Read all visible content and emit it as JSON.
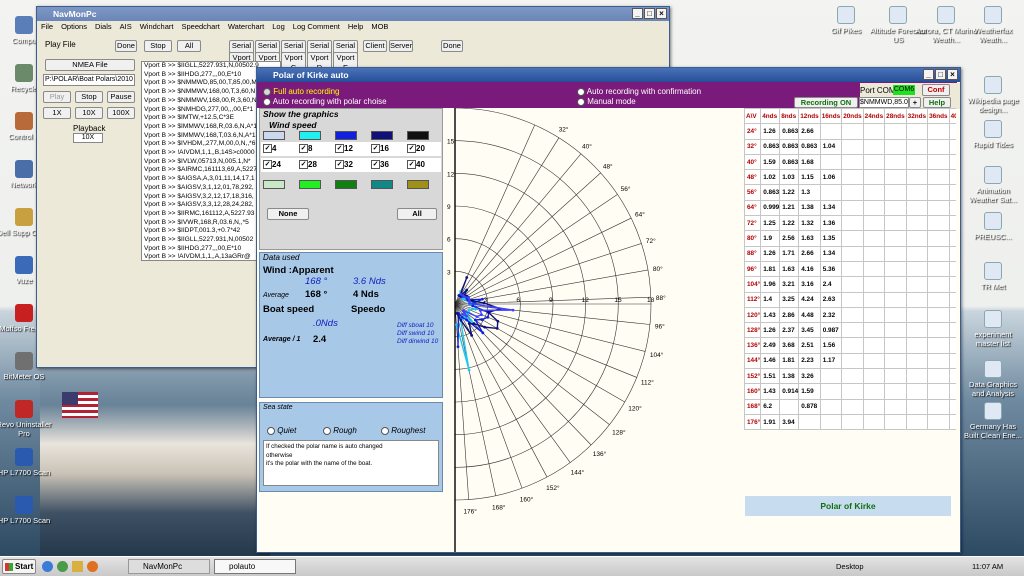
{
  "desktop": {
    "left_icons": [
      "Compu",
      "Recycle",
      "Control P",
      "Network",
      "Dell Supp Cente",
      "Vuze",
      "Moffso FreeCa",
      "BitMeter OS",
      "Revo Uninstaller Pro",
      "HP L7700 Scan",
      "HP L7700 Scan"
    ],
    "right_icons": [
      "Gif Pikes",
      "Altitude Forecast US",
      "Aurora, CT Marine Weath...",
      "Weatherfax Weath...",
      "Wikipedia page design...",
      "Rapid Tides",
      "Animation Weather Sat...",
      "PREUSC...",
      "TR Met",
      "experiment master list",
      "Data Graphics and Analysis",
      "Germany Has Built Clean Ene..."
    ]
  },
  "navmon": {
    "title": "NavMonPc",
    "menu": [
      "File",
      "Options",
      "Dials",
      "AIS",
      "Windchart",
      "Speedchart",
      "Waterchart",
      "Log",
      "Log Comment",
      "Help",
      "MOB"
    ],
    "play_file": "Play File",
    "done": "Done",
    "stop": "Stop",
    "all": "All",
    "nmea_file": "NMEA File",
    "path": "P:\\POLAR\\Boat Polars\\2010",
    "play": "Play",
    "stop2": "Stop",
    "pause": "Pause",
    "speeds": [
      "1X",
      "10X",
      "100X"
    ],
    "playback": "Playback",
    "playback_val": "10X",
    "serial_tabs": [
      "Serial A",
      "Serial B",
      "Serial C",
      "Serial D",
      "Serial E"
    ],
    "vport_tabs": [
      "Vport A",
      "Vport B",
      "Vport C",
      "Vport D",
      "Vport E"
    ],
    "client": "Client",
    "server": "Server",
    "log_lines": [
      "Vport B >> $IIGLL,5227.931,N,00502.9",
      "Vport B >> $IIHDG,277,,,00,E*10",
      "Vport B >> $NMMWD,85,00,T,85,00,M",
      "Vport B >> $NMMWV,168,00,T,3,60,N",
      "Vport B >> $NMMWV,168,00,R,3,60,N",
      "Vport B >> $NMHDG,277,00,,,00,E*1",
      "Vport B >> $IMTW,+12.5,C*3E",
      "Vport B >> $IMMWV,168,R,03.6,N,A*1",
      "Vport B >> $IMMWV,168,T,03.6,N,A*1",
      "Vport B >> $IVHDM,,277,M,00,0,N,,*6",
      "Vport B >> !AIVDM,1,1,,B,14S>c0000",
      "Vport B >> $IVLW,05713,N,005.1,N*",
      "Vport B >> $AIRMC,161113,69,A,5227",
      "Vport B >> $AIGSA,A,3,01,11,14,17,1",
      "Vport B >> $AIGSV,3,1,12,01,78,292,",
      "Vport B >> $AIGSV,3,2,12,17,18,316,",
      "Vport B >> $AIGSV,3,3,12,28,24,282,",
      "Vport B >> $IIRMC,161112,A,5227.93",
      "Vport B >> $IVWR,168,R,03.6,N,,*5",
      "Vport B >> $IIDPT,001.3,+0.7*42",
      "Vport B >> $IIGLL,5227.931,N,00502",
      "Vport B >> $IIHDG,277,,,00,E*10",
      "Vport B >> !AIVDM,1,1,,A,13aGRr@"
    ]
  },
  "polar": {
    "title": "Polar of Kirke auto",
    "options": [
      "Full auto recording",
      "Auto recording with polar choise",
      "Auto recording with confirmation",
      "Manual mode"
    ],
    "port_label": "Port COM",
    "port_val": "COM6",
    "conf": "Conf",
    "recording": "Recording ON",
    "mwd": "$NMMWD,85.0",
    "plus": "+",
    "help": "Help",
    "show_graphics": "Show the graphics",
    "wind_speed": "Wind speed",
    "speed_checks": [
      "4",
      "8",
      "12",
      "16",
      "20",
      "24",
      "28",
      "32",
      "36",
      "40"
    ],
    "row1_colors": [
      "#ccd8ee",
      "#20f0f0",
      "#1020e0",
      "#101078",
      "#101010"
    ],
    "row4_colors": [
      "#c8e8c8",
      "#20f020",
      "#108010",
      "#108888",
      "#a09018"
    ],
    "none": "None",
    "all": "All",
    "data_used": "Data used",
    "wind_apparent": "Wind :Apparent",
    "wind_deg": "168 °",
    "wind_nds": "3.6 Nds",
    "average": "Average",
    "avg_deg": "168 °",
    "avg_nds": "4 Nds",
    "boat_speed": "Boat speed",
    "speedo": "Speedo",
    "boat_val": ".0Nds",
    "avg1": "Average / 1",
    "avg1_val": "2.4",
    "diff_sboat": "Diff sboat 10",
    "diff_swind": "Diff swind 10",
    "diff_dirwind": "Diff dirwind 10",
    "sea_state": "Sea state",
    "sea_opts": [
      "Quiet",
      "Rough",
      "Roughest"
    ],
    "note_lines": [
      "If checked the polar name is auto changed",
      "otherwise",
      "it's the polar with the name of the boat."
    ],
    "footer": "Polar of Kirke"
  },
  "polar_chart": {
    "angles": [
      "32°",
      "40°",
      "48°",
      "56°",
      "64°",
      "72°",
      "80°",
      "88°",
      "96°",
      "104°",
      "112°",
      "120°",
      "128°",
      "136°",
      "144°",
      "152°",
      "160°",
      "168°",
      "176°"
    ],
    "radial_ticks": [
      "3",
      "6",
      "9",
      "12",
      "15",
      "18"
    ],
    "left_ticks": [
      "15",
      "12",
      "9",
      "6",
      "3"
    ],
    "rmax": 18
  },
  "table": {
    "headers": [
      "A\\V",
      "4nds",
      "8nds",
      "12nds",
      "16nds",
      "20nds",
      "24nds",
      "28nds",
      "32nds",
      "36nds",
      "40nds"
    ],
    "rows": [
      [
        "24°",
        "1.26",
        "0.863",
        "2.66",
        "",
        "",
        "",
        "",
        "",
        "",
        ""
      ],
      [
        "32°",
        "0.863",
        "0.863",
        "0.863",
        "1.04",
        "",
        "",
        "",
        "",
        "",
        ""
      ],
      [
        "40°",
        "1.59",
        "0.863",
        "1.68",
        "",
        "",
        "",
        "",
        "",
        "",
        ""
      ],
      [
        "48°",
        "1.02",
        "1.03",
        "1.15",
        "1.06",
        "",
        "",
        "",
        "",
        "",
        ""
      ],
      [
        "56°",
        "0.863",
        "1.22",
        "1.3",
        "",
        "",
        "",
        "",
        "",
        "",
        ""
      ],
      [
        "64°",
        "0.999",
        "1.21",
        "1.38",
        "1.34",
        "",
        "",
        "",
        "",
        "",
        ""
      ],
      [
        "72°",
        "1.25",
        "1.22",
        "1.32",
        "1.36",
        "",
        "",
        "",
        "",
        "",
        ""
      ],
      [
        "80°",
        "1.9",
        "2.56",
        "1.63",
        "1.35",
        "",
        "",
        "",
        "",
        "",
        ""
      ],
      [
        "88°",
        "1.26",
        "1.71",
        "2.66",
        "1.34",
        "",
        "",
        "",
        "",
        "",
        ""
      ],
      [
        "96°",
        "1.81",
        "1.63",
        "4.16",
        "5.36",
        "",
        "",
        "",
        "",
        "",
        ""
      ],
      [
        "104°",
        "1.96",
        "3.21",
        "3.16",
        "2.4",
        "",
        "",
        "",
        "",
        "",
        ""
      ],
      [
        "112°",
        "1.4",
        "3.25",
        "4.24",
        "2.63",
        "",
        "",
        "",
        "",
        "",
        ""
      ],
      [
        "120°",
        "1.43",
        "2.86",
        "4.48",
        "2.32",
        "",
        "",
        "",
        "",
        "",
        ""
      ],
      [
        "128°",
        "1.26",
        "2.37",
        "3.45",
        "0.987",
        "",
        "",
        "",
        "",
        "",
        ""
      ],
      [
        "136°",
        "2.49",
        "3.68",
        "2.51",
        "1.56",
        "",
        "",
        "",
        "",
        "",
        ""
      ],
      [
        "144°",
        "1.46",
        "1.81",
        "2.23",
        "1.17",
        "",
        "",
        "",
        "",
        "",
        ""
      ],
      [
        "152°",
        "1.51",
        "1.38",
        "3.26",
        "",
        "",
        "",
        "",
        "",
        "",
        ""
      ],
      [
        "160°",
        "1.43",
        "0.914",
        "1.59",
        "",
        "",
        "",
        "",
        "",
        "",
        ""
      ],
      [
        "168°",
        "6.2",
        "",
        "0.878",
        "",
        "",
        "",
        "",
        "",
        "",
        ""
      ],
      [
        "176°",
        "1.91",
        "3.94",
        "",
        "",
        "",
        "",
        "",
        "",
        "",
        ""
      ]
    ]
  },
  "taskbar": {
    "start": "Start",
    "items": [
      "NavMonPc",
      "polauto"
    ],
    "desktop": "Desktop",
    "time": "11:07 AM"
  }
}
